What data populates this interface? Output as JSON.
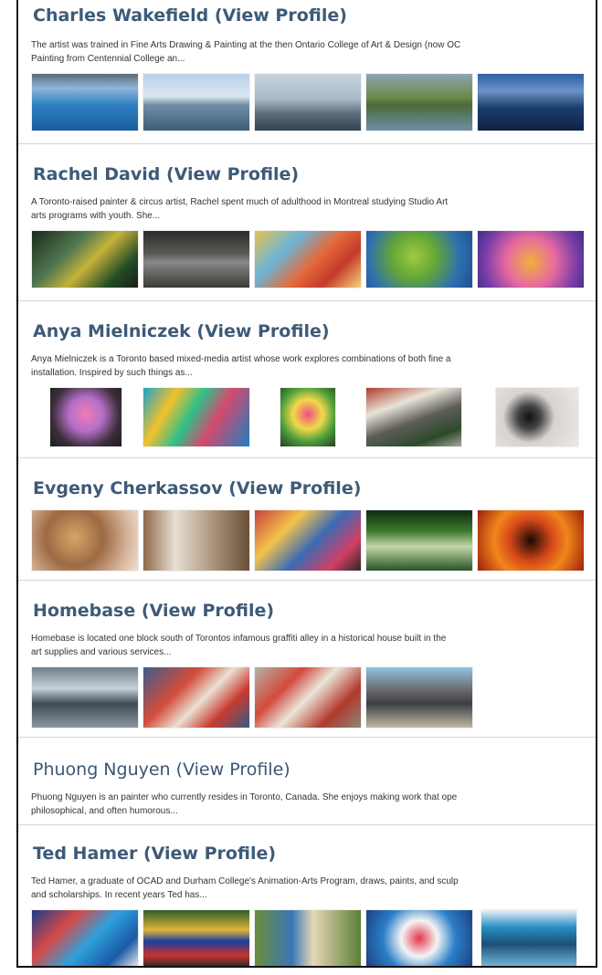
{
  "artists": [
    {
      "name": "Charles Wakefield",
      "link": "(View Profile)",
      "desc_lines": [
        "The artist was trained in Fine Arts Drawing & Painting at the then Ontario College of Art & Design (now OC",
        "Painting from Centennial College an..."
      ],
      "thumbs": [
        "lake-shoreline",
        "lake-view",
        "harbor-skyline",
        "pond",
        "night-reflection"
      ]
    },
    {
      "name": "Rachel David",
      "link": "(View Profile)",
      "desc_lines": [
        "A Toronto-raised painter & circus artist, Rachel spent much of adulthood in Montreal studying Studio Art",
        "arts programs with youth. She..."
      ],
      "thumbs": [
        "mural",
        "dark-interior",
        "poster-art",
        "green-face",
        "pink-face"
      ]
    },
    {
      "name": "Anya Mielniczek",
      "link": "(View Profile)",
      "desc_lines": [
        "Anya Mielniczek is a Toronto based mixed-media artist whose work explores combinations of both fine a",
        "installation. Inspired by such things as..."
      ],
      "thumbs": [
        "face-mural",
        "wave-mural",
        "rose-painting",
        "street-sign",
        "ink-portrait"
      ]
    },
    {
      "name": "Evgeny Cherkassov",
      "link": "(View Profile)",
      "desc_lines": [],
      "thumbs": [
        "portrait",
        "studio",
        "painted-room",
        "green-scene",
        "red-abstract"
      ]
    },
    {
      "name": "Homebase",
      "link": "(View Profile)",
      "desc_lines": [
        "Homebase is located one block south of Torontos infamous graffiti alley in a historical house built in the",
        "art supplies and various services..."
      ],
      "thumbs": [
        "city-aerial",
        "fish-mural",
        "koi-mural",
        "graffiti-wall"
      ]
    },
    {
      "name": "Phuong Nguyen",
      "link": "(View Profile)",
      "desc_lines": [
        "Phuong Nguyen is an painter who currently resides in Toronto, Canada. She enjoys making work that ope",
        "philosophical, and often humorous..."
      ],
      "thumbs": []
    },
    {
      "name": "Ted Hamer",
      "link": "(View Profile)",
      "desc_lines": [
        "Ted Hamer, a graduate of OCAD and Durham College's Animation-Arts Program, draws, paints, and sculp",
        "and scholarships. In recent years Ted has..."
      ],
      "thumbs": [
        "blue-collage",
        "train-mural",
        "bus-panels",
        "graffiti-piece",
        "blue-wall"
      ]
    }
  ]
}
